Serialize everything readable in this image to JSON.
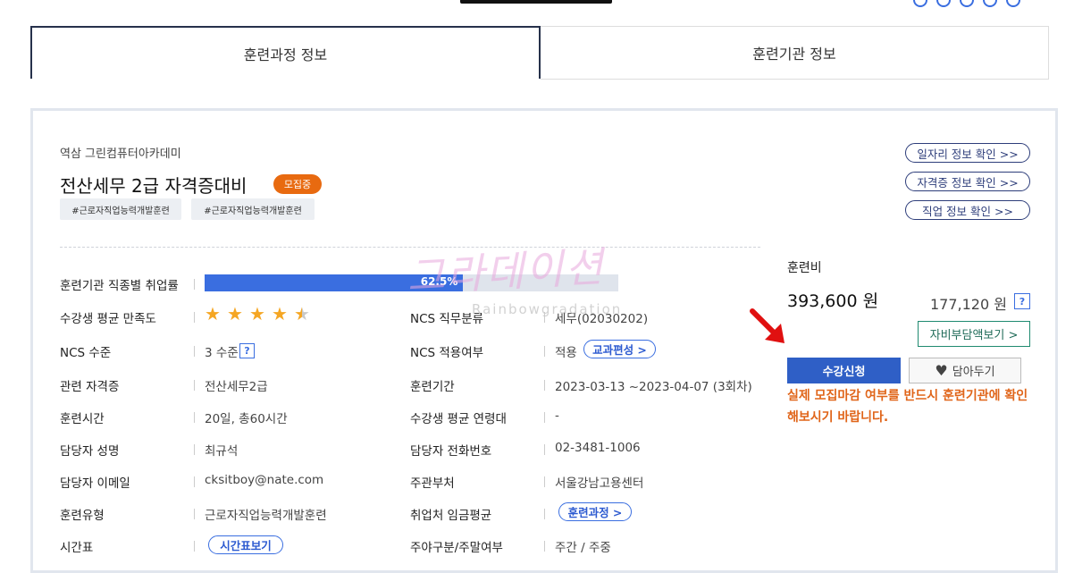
{
  "tabs": {
    "course_info": "훈련과정 정보",
    "institution_info": "훈련기관 정보"
  },
  "course": {
    "institution": "역삼 그린컴퓨터아카데미",
    "title": "전산세무 2급 자격증대비",
    "status_badge": "모집중",
    "tags": [
      "#근로자직업능력개발훈련",
      "#근로자직업능력개발훈련"
    ]
  },
  "links": {
    "job_info": "일자리 정보 확인 >>",
    "cert_info": "자격증 정보 확인 >>",
    "occupation_info": "직업 정보 확인 >>"
  },
  "details": {
    "employment_rate_label": "훈련기관 직종별 취업률",
    "employment_rate_value": "62.5%",
    "employment_rate_fraction": 0.625,
    "satisfaction_label": "수강생 평균 만족도",
    "satisfaction_stars": 4.5,
    "ncs_class_label": "NCS 직무분류",
    "ncs_class_value": "세무(02030202)",
    "ncs_level_label": "NCS 수준",
    "ncs_level_value": "3 수준",
    "ncs_apply_label": "NCS 적용여부",
    "ncs_apply_value": "적용",
    "curriculum_btn": "교과편성 >",
    "cert_label": "관련 자격증",
    "cert_value": "전산세무2급",
    "period_label": "훈련기간",
    "period_value": "2023-03-13 ~2023-04-07 (3회차)",
    "hours_label": "훈련시간",
    "hours_value": "20일, 총60시간",
    "age_label": "수강생 평균 연령대",
    "age_value": "-",
    "manager_label": "담당자 성명",
    "manager_value": "최규석",
    "phone_label": "담당자 전화번호",
    "phone_value": "02-3481-1006",
    "email_label": "담당자 이메일",
    "email_value": "cksitboy@nate.com",
    "dept_label": "주관부처",
    "dept_value": "서울강남고용센터",
    "type_label": "훈련유형",
    "type_value": "근로자직업능력개발훈련",
    "wage_label": "취업처 임금평균",
    "wage_btn": "훈련과정 >",
    "schedule_label": "시간표",
    "schedule_btn": "시간표보기",
    "daynight_label": "주야구분/주말여부",
    "daynight_value": "주간 / 주중"
  },
  "fee": {
    "label": "훈련비",
    "amount": "393,600 원",
    "self_pay": "177,120 원",
    "self_pay_btn": "자비부담액보기 >",
    "apply_btn": "수강신청",
    "save_btn": "담아두기",
    "notice": "실제 모집마감 여부를 반드시 훈련기관에 확인해보시기 바랍니다."
  },
  "watermark": {
    "main": "그라데이션",
    "sub": "Rainbowgradation"
  },
  "colors": {
    "accent": "#3a6ee0",
    "badge": "#e86a10",
    "notice": "#e0651a",
    "apply": "#2f5fc6",
    "arrow": "#e01010"
  }
}
